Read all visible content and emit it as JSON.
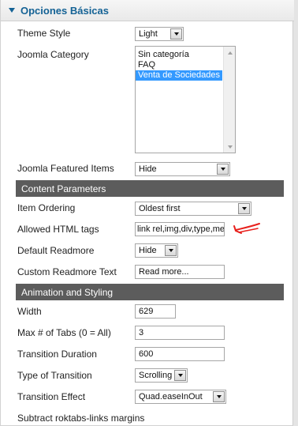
{
  "header": {
    "title": "Opciones Básicas",
    "icon": "collapse-triangle-icon",
    "accent": "#146295"
  },
  "theme_style": {
    "label": "Theme Style",
    "value": "Light"
  },
  "joomla_category": {
    "label": "Joomla Category",
    "options": [
      "Sin categoría",
      "FAQ",
      "Venta de Sociedades"
    ],
    "selected": "Venta de Sociedades"
  },
  "featured_items": {
    "label": "Joomla Featured Items",
    "value": "Hide"
  },
  "content_parameters": {
    "title": "Content Parameters",
    "item_ordering": {
      "label": "Item Ordering",
      "value": "Oldest first"
    },
    "allowed_html": {
      "label": "Allowed HTML tags",
      "value": "link rel,img,div,type,med"
    },
    "default_readmore": {
      "label": "Default Readmore",
      "value": "Hide"
    },
    "custom_readmore": {
      "label": "Custom Readmore Text",
      "value": "Read more..."
    }
  },
  "animation": {
    "title": "Animation and Styling",
    "width": {
      "label": "Width",
      "value": "629"
    },
    "max_tabs": {
      "label": "Max # of Tabs (0 = All)",
      "value": "3"
    },
    "duration": {
      "label": "Transition Duration",
      "value": "600"
    },
    "type": {
      "label": "Type of Transition",
      "value": "Scrolling"
    },
    "effect": {
      "label": "Transition Effect",
      "value": "Quad.easeInOut"
    },
    "subtract_margins": {
      "label": "Subtract roktabs-links margins"
    }
  },
  "annotation": {
    "color": "#e8201c",
    "icon": "red-arrow-annotation-icon"
  },
  "colors": {
    "section_bg": "#5c5c5c",
    "selection": "#3399ff"
  }
}
